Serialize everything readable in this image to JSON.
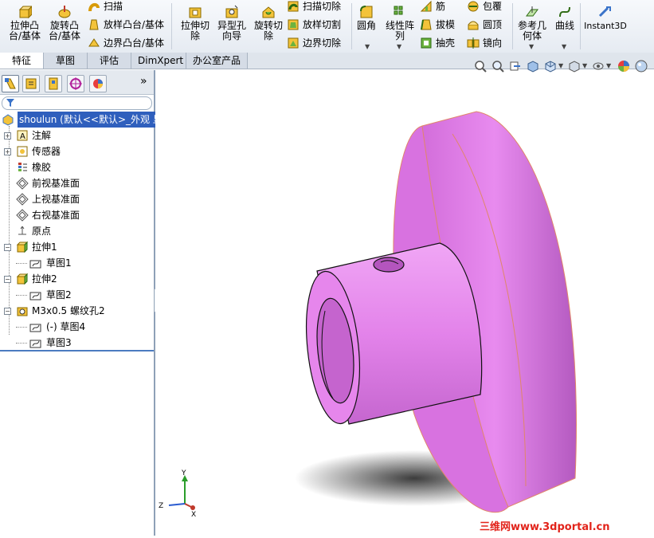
{
  "ribbon": {
    "extrude_boss": "拉伸凸\n台/基体",
    "revolve_boss": "旋转凸\n台/基体",
    "sweep": "扫描",
    "loft_boss": "放样凸台/基体",
    "boundary_boss": "边界凸台/基体",
    "extrude_cut": "拉伸切\n除",
    "hole_wizard": "异型孔\n向导",
    "revolve_cut": "旋转切\n除",
    "swept_cut": "扫描切除",
    "lofted_cut": "放样切割",
    "boundary_cut": "边界切除",
    "fillet": "圆角",
    "linear_pattern": "线性阵\n列",
    "rib": "筋",
    "draft": "拔模",
    "shell": "抽壳",
    "wrap": "包覆",
    "dome": "圆顶",
    "mirror": "镜向",
    "ref_geometry": "参考几\n何体",
    "curves": "曲线",
    "instant3d": "Instant3D"
  },
  "tabs": [
    "特征",
    "草图",
    "评估",
    "DimXpert",
    "办公室产品"
  ],
  "tree": {
    "root": "shoulun  (默认<<默认>_外观 显",
    "items": [
      {
        "label": "注解",
        "icon": "annotation-icon"
      },
      {
        "label": "传感器",
        "icon": "sensor-icon"
      },
      {
        "label": "橡胶",
        "icon": "material-icon"
      },
      {
        "label": "前视基准面",
        "icon": "plane-icon"
      },
      {
        "label": "上视基准面",
        "icon": "plane-icon"
      },
      {
        "label": "右视基准面",
        "icon": "plane-icon"
      },
      {
        "label": "原点",
        "icon": "origin-icon"
      },
      {
        "label": "拉伸1",
        "icon": "extrude-icon"
      },
      {
        "label": "草图1",
        "icon": "sketch-icon"
      },
      {
        "label": "拉伸2",
        "icon": "extrude-icon"
      },
      {
        "label": "草图2",
        "icon": "sketch-icon"
      },
      {
        "label": "M3x0.5 螺纹孔2",
        "icon": "hole-icon"
      },
      {
        "label": "(-) 草图4",
        "icon": "sketch-icon"
      },
      {
        "label": "草图3",
        "icon": "sketch-icon"
      }
    ]
  },
  "triad": {
    "y": "Y",
    "z": "Z",
    "x": "X"
  },
  "watermark": "三维网www.3dportal.cn",
  "colors": {
    "part": "#e07be6",
    "part_edge": "#e0866a",
    "selection": "#2f5fbd",
    "watermark": "#e2231a"
  }
}
